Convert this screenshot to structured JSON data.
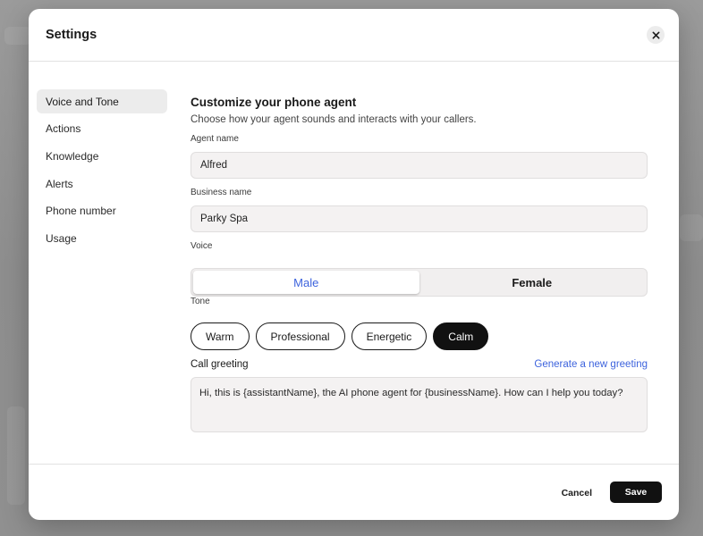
{
  "modal": {
    "title": "Settings",
    "close_icon": "close-icon"
  },
  "sidebar": {
    "items": [
      {
        "label": "Voice and Tone",
        "active": true
      },
      {
        "label": "Actions",
        "active": false
      },
      {
        "label": "Knowledge",
        "active": false
      },
      {
        "label": "Alerts",
        "active": false
      },
      {
        "label": "Phone number",
        "active": false
      },
      {
        "label": "Usage",
        "active": false
      }
    ]
  },
  "content": {
    "title": "Customize your phone agent",
    "description": "Choose how your agent sounds and interacts with your callers.",
    "agent_name": {
      "label": "Agent name",
      "value": "Alfred"
    },
    "business_name": {
      "label": "Business name",
      "value": "Parky Spa"
    },
    "voice": {
      "label": "Voice",
      "options": [
        "Male",
        "Female"
      ],
      "selected": "Male"
    },
    "tone": {
      "label": "Tone",
      "options": [
        "Warm",
        "Professional",
        "Energetic",
        "Calm"
      ],
      "selected": "Calm"
    },
    "greeting": {
      "label": "Call greeting",
      "link": "Generate a new greeting",
      "value": "Hi, this is {assistantName}, the AI phone agent for {businessName}. How can I help you today?"
    }
  },
  "footer": {
    "cancel_label": "Cancel",
    "save_label": "Save"
  },
  "colors": {
    "accent": "#3d63dd",
    "primary_button": "#111111"
  }
}
